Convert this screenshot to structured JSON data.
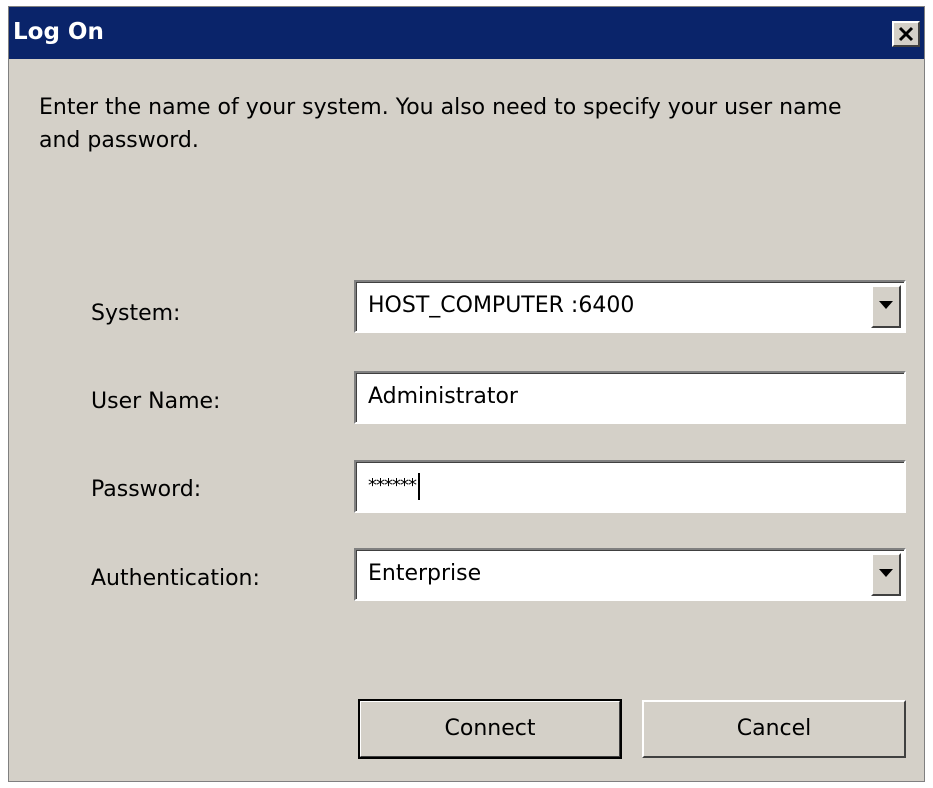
{
  "window": {
    "title": "Log On",
    "close_icon": "close-x-icon"
  },
  "instructions": "Enter the name of your system. You also need to specify your user name and password.",
  "form": {
    "system": {
      "label": "System:",
      "value": "HOST_COMPUTER :6400"
    },
    "user_name": {
      "label": "User Name:",
      "value": "Administrator"
    },
    "password": {
      "label": "Password:",
      "value": "******"
    },
    "authentication": {
      "label": "Authentication:",
      "value": "Enterprise"
    }
  },
  "buttons": {
    "connect": "Connect",
    "cancel": "Cancel"
  },
  "colors": {
    "title_bar": "#0a246a",
    "dialog_bg": "#d4d0c8"
  }
}
